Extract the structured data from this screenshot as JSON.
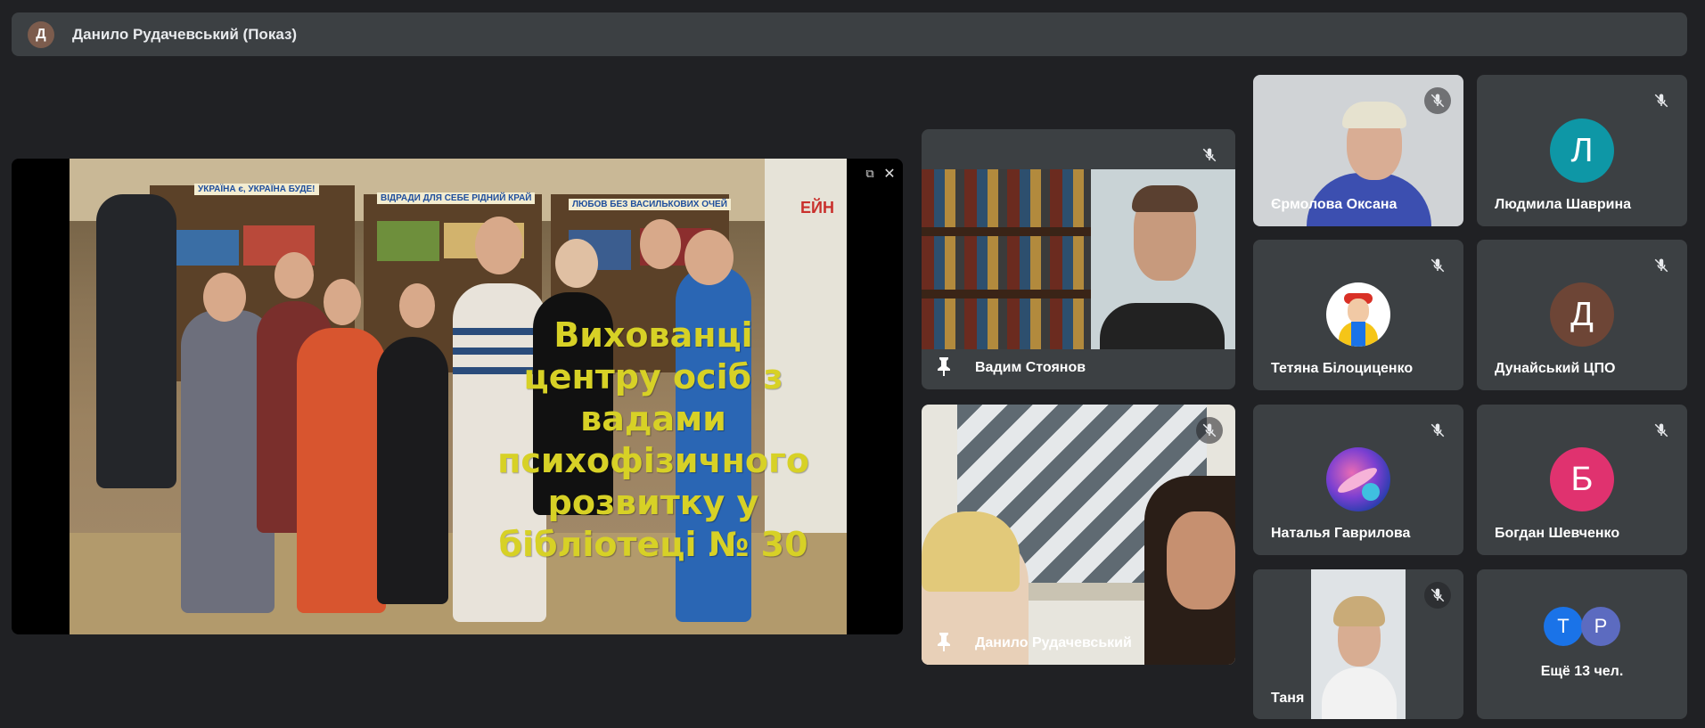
{
  "banner": {
    "avatar_letter": "Д",
    "presenter": "Данило Рудачевський (Показ)"
  },
  "presentation": {
    "slide_lines": [
      "Вихованці",
      "центру осіб з",
      "вадами",
      "психофізичного",
      "розвитку у",
      "бібліотеці № 30"
    ],
    "shelf_signs": [
      "УКРАЇНА є, УКРАЇНА БУДЕ!",
      "ВІДРАДИ ДЛЯ СЕБЕ РІДНИЙ КРАЙ",
      "ЛЮБОВ БЕЗ ВАСИЛЬКОВИХ ОЧЕЙ"
    ],
    "side_sign": "ЕЙН"
  },
  "participants": {
    "vadym": {
      "name": "Вадим Стоянов"
    },
    "danylo": {
      "name": "Данило Рудачевський"
    },
    "oksana": {
      "name": "Єрмолова Оксана"
    },
    "liudmyla": {
      "name": "Людмила Шаврина",
      "letter": "Л",
      "color": "#0e97a6"
    },
    "tetiana": {
      "name": "Тетяна Білоциценко"
    },
    "dunaiskyi": {
      "name": "Дунайський ЦПО",
      "letter": "Д",
      "color": "#6d4536"
    },
    "natalia": {
      "name": "Наталья Гаврилова"
    },
    "bohdan": {
      "name": "Богдан Шевченко",
      "letter": "Б",
      "color": "#e0326f"
    },
    "tania": {
      "name": "Таня"
    },
    "more": {
      "label": "Ещё 13 чел.",
      "letters": [
        "Т",
        "Р"
      ],
      "colors": [
        "#1a73e8",
        "#5c6bc0"
      ]
    }
  }
}
